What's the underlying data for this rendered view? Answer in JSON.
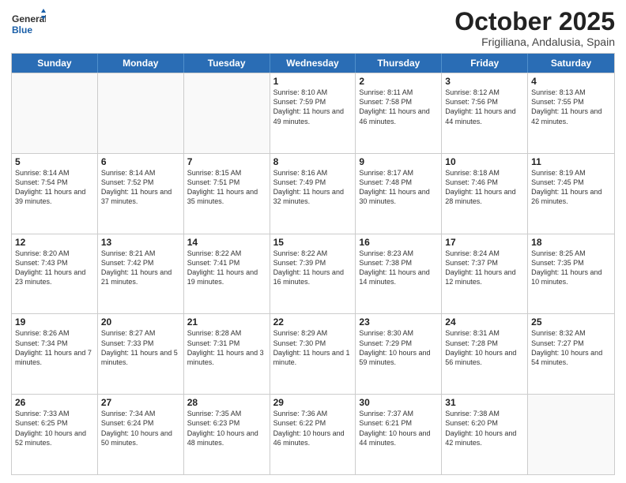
{
  "logo": {
    "general": "General",
    "blue": "Blue"
  },
  "title": "October 2025",
  "subtitle": "Frigiliana, Andalusia, Spain",
  "weekdays": [
    "Sunday",
    "Monday",
    "Tuesday",
    "Wednesday",
    "Thursday",
    "Friday",
    "Saturday"
  ],
  "rows": [
    [
      {
        "day": "",
        "info": ""
      },
      {
        "day": "",
        "info": ""
      },
      {
        "day": "",
        "info": ""
      },
      {
        "day": "1",
        "info": "Sunrise: 8:10 AM\nSunset: 7:59 PM\nDaylight: 11 hours and 49 minutes."
      },
      {
        "day": "2",
        "info": "Sunrise: 8:11 AM\nSunset: 7:58 PM\nDaylight: 11 hours and 46 minutes."
      },
      {
        "day": "3",
        "info": "Sunrise: 8:12 AM\nSunset: 7:56 PM\nDaylight: 11 hours and 44 minutes."
      },
      {
        "day": "4",
        "info": "Sunrise: 8:13 AM\nSunset: 7:55 PM\nDaylight: 11 hours and 42 minutes."
      }
    ],
    [
      {
        "day": "5",
        "info": "Sunrise: 8:14 AM\nSunset: 7:54 PM\nDaylight: 11 hours and 39 minutes."
      },
      {
        "day": "6",
        "info": "Sunrise: 8:14 AM\nSunset: 7:52 PM\nDaylight: 11 hours and 37 minutes."
      },
      {
        "day": "7",
        "info": "Sunrise: 8:15 AM\nSunset: 7:51 PM\nDaylight: 11 hours and 35 minutes."
      },
      {
        "day": "8",
        "info": "Sunrise: 8:16 AM\nSunset: 7:49 PM\nDaylight: 11 hours and 32 minutes."
      },
      {
        "day": "9",
        "info": "Sunrise: 8:17 AM\nSunset: 7:48 PM\nDaylight: 11 hours and 30 minutes."
      },
      {
        "day": "10",
        "info": "Sunrise: 8:18 AM\nSunset: 7:46 PM\nDaylight: 11 hours and 28 minutes."
      },
      {
        "day": "11",
        "info": "Sunrise: 8:19 AM\nSunset: 7:45 PM\nDaylight: 11 hours and 26 minutes."
      }
    ],
    [
      {
        "day": "12",
        "info": "Sunrise: 8:20 AM\nSunset: 7:43 PM\nDaylight: 11 hours and 23 minutes."
      },
      {
        "day": "13",
        "info": "Sunrise: 8:21 AM\nSunset: 7:42 PM\nDaylight: 11 hours and 21 minutes."
      },
      {
        "day": "14",
        "info": "Sunrise: 8:22 AM\nSunset: 7:41 PM\nDaylight: 11 hours and 19 minutes."
      },
      {
        "day": "15",
        "info": "Sunrise: 8:22 AM\nSunset: 7:39 PM\nDaylight: 11 hours and 16 minutes."
      },
      {
        "day": "16",
        "info": "Sunrise: 8:23 AM\nSunset: 7:38 PM\nDaylight: 11 hours and 14 minutes."
      },
      {
        "day": "17",
        "info": "Sunrise: 8:24 AM\nSunset: 7:37 PM\nDaylight: 11 hours and 12 minutes."
      },
      {
        "day": "18",
        "info": "Sunrise: 8:25 AM\nSunset: 7:35 PM\nDaylight: 11 hours and 10 minutes."
      }
    ],
    [
      {
        "day": "19",
        "info": "Sunrise: 8:26 AM\nSunset: 7:34 PM\nDaylight: 11 hours and 7 minutes."
      },
      {
        "day": "20",
        "info": "Sunrise: 8:27 AM\nSunset: 7:33 PM\nDaylight: 11 hours and 5 minutes."
      },
      {
        "day": "21",
        "info": "Sunrise: 8:28 AM\nSunset: 7:31 PM\nDaylight: 11 hours and 3 minutes."
      },
      {
        "day": "22",
        "info": "Sunrise: 8:29 AM\nSunset: 7:30 PM\nDaylight: 11 hours and 1 minute."
      },
      {
        "day": "23",
        "info": "Sunrise: 8:30 AM\nSunset: 7:29 PM\nDaylight: 10 hours and 59 minutes."
      },
      {
        "day": "24",
        "info": "Sunrise: 8:31 AM\nSunset: 7:28 PM\nDaylight: 10 hours and 56 minutes."
      },
      {
        "day": "25",
        "info": "Sunrise: 8:32 AM\nSunset: 7:27 PM\nDaylight: 10 hours and 54 minutes."
      }
    ],
    [
      {
        "day": "26",
        "info": "Sunrise: 7:33 AM\nSunset: 6:25 PM\nDaylight: 10 hours and 52 minutes."
      },
      {
        "day": "27",
        "info": "Sunrise: 7:34 AM\nSunset: 6:24 PM\nDaylight: 10 hours and 50 minutes."
      },
      {
        "day": "28",
        "info": "Sunrise: 7:35 AM\nSunset: 6:23 PM\nDaylight: 10 hours and 48 minutes."
      },
      {
        "day": "29",
        "info": "Sunrise: 7:36 AM\nSunset: 6:22 PM\nDaylight: 10 hours and 46 minutes."
      },
      {
        "day": "30",
        "info": "Sunrise: 7:37 AM\nSunset: 6:21 PM\nDaylight: 10 hours and 44 minutes."
      },
      {
        "day": "31",
        "info": "Sunrise: 7:38 AM\nSunset: 6:20 PM\nDaylight: 10 hours and 42 minutes."
      },
      {
        "day": "",
        "info": ""
      }
    ]
  ]
}
